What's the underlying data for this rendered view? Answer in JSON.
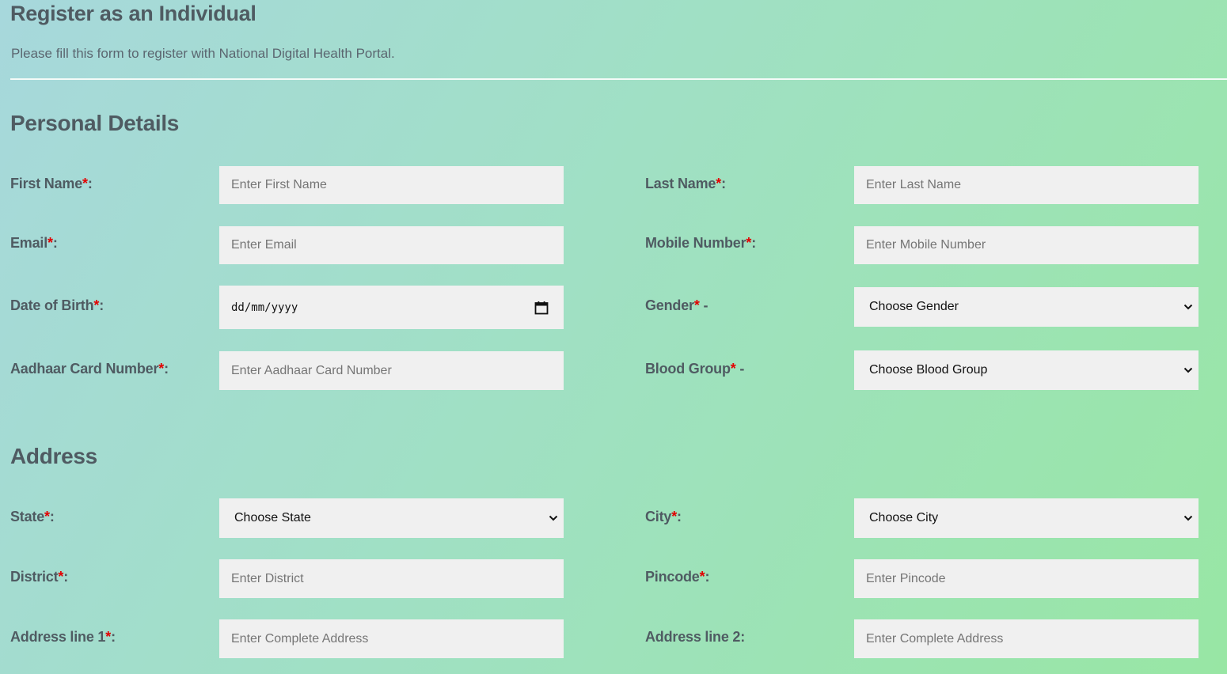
{
  "header": {
    "title": "Register as an Individual",
    "subtitle": "Please fill this form to register with National Digital Health Portal."
  },
  "personal": {
    "title": "Personal Details",
    "first_name_label": "First Name",
    "first_name_placeholder": "Enter First Name",
    "last_name_label": "Last Name",
    "last_name_placeholder": "Enter Last Name",
    "email_label": "Email",
    "email_placeholder": "Enter Email",
    "mobile_label": "Mobile Number",
    "mobile_placeholder": "Enter Mobile Number",
    "dob_label": "Date of Birth",
    "dob_value": "dd/mm/yyyy",
    "gender_label": "Gender",
    "gender_value": "Choose Gender",
    "aadhaar_label": "Aadhaar Card Number",
    "aadhaar_placeholder": "Enter Aadhaar Card Number",
    "blood_label": "Blood Group",
    "blood_value": "Choose Blood Group"
  },
  "address": {
    "title": "Address",
    "state_label": "State",
    "state_value": "Choose State",
    "city_label": "City",
    "city_value": "Choose City",
    "district_label": "District",
    "district_placeholder": "Enter District",
    "pincode_label": "Pincode",
    "pincode_placeholder": "Enter Pincode",
    "line1_label": "Address line 1",
    "line1_placeholder": "Enter Complete Address",
    "line2_label": "Address line 2:",
    "line2_placeholder": "Enter Complete Address"
  },
  "common": {
    "required_mark": "*",
    "colon": ":",
    "dash": " -"
  },
  "colors": {
    "required": "#e30000",
    "field_bg": "#f0f0f0",
    "text": "#4f5b62"
  }
}
